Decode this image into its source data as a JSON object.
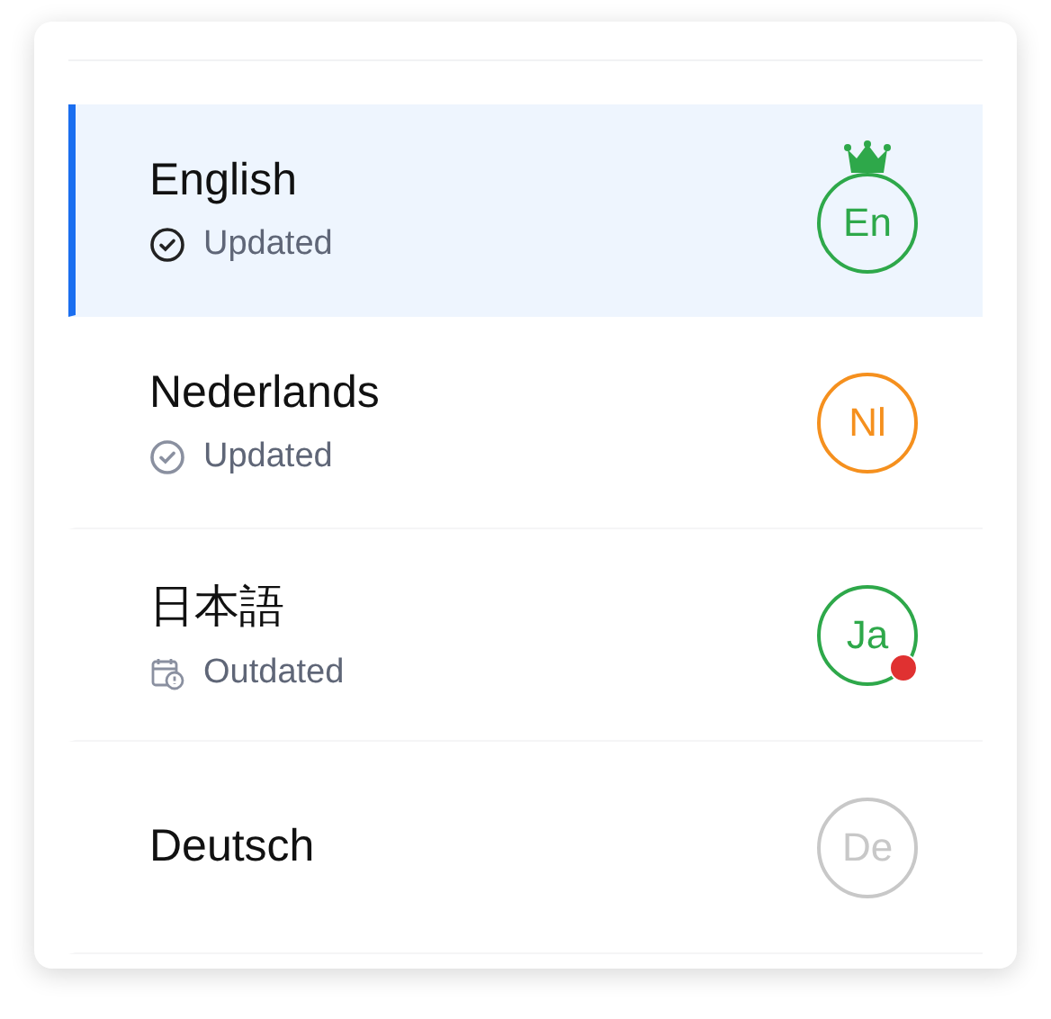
{
  "languages": [
    {
      "name": "English",
      "status": {
        "kind": "updated",
        "text": "Updated"
      },
      "badge": {
        "text": "En",
        "color": "#2ea84a",
        "crown": true,
        "alert": false
      },
      "selected": true
    },
    {
      "name": "Nederlands",
      "status": {
        "kind": "updated",
        "text": "Updated"
      },
      "badge": {
        "text": "Nl",
        "color": "#f5901e",
        "crown": false,
        "alert": false
      },
      "selected": false
    },
    {
      "name": "日本語",
      "status": {
        "kind": "outdated",
        "text": "Outdated"
      },
      "badge": {
        "text": "Ja",
        "color": "#2ea84a",
        "crown": false,
        "alert": true
      },
      "selected": false
    },
    {
      "name": "Deutsch",
      "badge": {
        "text": "De",
        "color": "#c8c8c8",
        "crown": false,
        "alert": false
      },
      "selected": false
    }
  ]
}
